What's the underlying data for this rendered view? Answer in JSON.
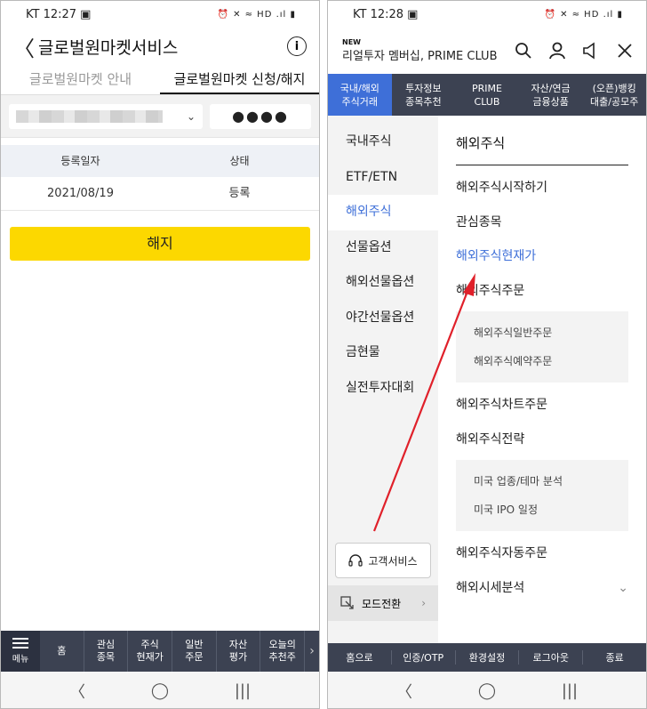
{
  "left": {
    "status": {
      "carrier_time": "KT 12:27 ▣",
      "icons": "⏰ ✕ ≈ HD .ıl ▮"
    },
    "header": {
      "back": "〈",
      "title": "글로벌원마켓서비스",
      "info": "i"
    },
    "tabs": [
      {
        "label": "글로벌원마켓 안내"
      },
      {
        "label": "글로벌원마켓 신청/해지"
      }
    ],
    "account": {
      "chevron": "⌄",
      "password": "●●●●"
    },
    "table": {
      "headers": [
        "등록일자",
        "상태"
      ],
      "rows": [
        [
          "2021/08/19",
          "등록"
        ]
      ]
    },
    "cancel_button": "해지",
    "bottom_nav": {
      "menu": "메뉴",
      "items": [
        "홈",
        "관심\n종목",
        "주식\n현재가",
        "일반\n주문",
        "자산\n평가",
        "오늘의\n추천주"
      ],
      "more": "›"
    },
    "sys_nav": [
      "〈",
      "◯",
      "|||"
    ]
  },
  "right": {
    "status": {
      "carrier_time": "KT 12:28 ▣",
      "icons": "⏰ ✕ ≈ HD .ıl ▮"
    },
    "brand": {
      "new": "NEW",
      "name": "리얼투자 멤버십, PRIME CLUB"
    },
    "tabs": [
      {
        "label": "국내/해외\n주식거래"
      },
      {
        "label": "투자정보\n종목추천"
      },
      {
        "label": "PRIME\nCLUB"
      },
      {
        "label": "자산/연금\n금융상품"
      },
      {
        "label": "(오픈)뱅킹\n대출/공모주"
      }
    ],
    "side_menu": [
      "국내주식",
      "ETF/ETN",
      "해외주식",
      "선물옵션",
      "해외선물옵션",
      "야간선물옵션",
      "금현물",
      "실전투자대회"
    ],
    "main_title": "해외주식",
    "main_items_a": [
      "해외주식시작하기",
      "관심종목",
      "해외주식현재가",
      "해외주식주문"
    ],
    "sub_a": [
      "해외주식일반주문",
      "해외주식예약주문"
    ],
    "main_items_b": [
      "해외주식차트주문",
      "해외주식전략"
    ],
    "sub_b": [
      "미국 업종/테마 분석",
      "미국 IPO 일정"
    ],
    "main_items_c": [
      "해외주식자동주문",
      "해외시세분석"
    ],
    "expand": "⌄",
    "cs_button": "고객서비스",
    "mode_button": "모드전환",
    "mode_arrow": "›",
    "footer": [
      "홈으로",
      "인증/OTP",
      "환경설정",
      "로그아웃",
      "종료"
    ],
    "sys_nav": [
      "〈",
      "◯",
      "|||"
    ],
    "annotation_color": "#e0202a"
  }
}
